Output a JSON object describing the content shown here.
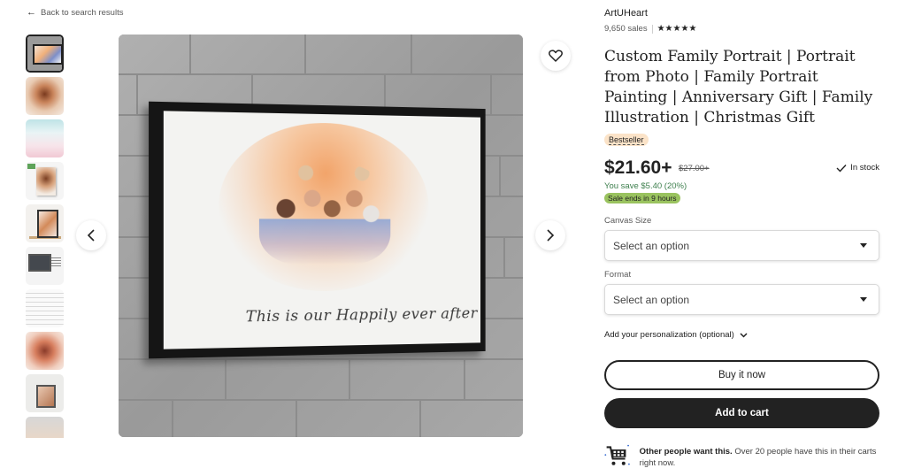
{
  "nav": {
    "back_label": "Back to search results",
    "back_icon": "arrow-left-icon"
  },
  "gallery": {
    "thumbnails": [
      {
        "alt": "Framed family portrait on brick wall",
        "active": true
      },
      {
        "alt": "Watercolor portrait close-up",
        "active": false
      },
      {
        "alt": "Step by step guide",
        "active": false
      },
      {
        "alt": "Canvas side view",
        "active": false
      },
      {
        "alt": "Framed portrait on shelf",
        "active": false
      },
      {
        "alt": "Digital download on monitor",
        "active": false
      },
      {
        "alt": "Size chart table",
        "active": false
      },
      {
        "alt": "Mother and children portrait",
        "active": false
      },
      {
        "alt": "Framed portrait interior",
        "active": false
      },
      {
        "alt": "Portrait variations",
        "active": false
      }
    ],
    "main_image": {
      "alt": "Custom watercolor family portrait canvas on grey brick wall",
      "caption_text": "This is our Happily ever after"
    },
    "prev_icon": "chevron-left-icon",
    "next_icon": "chevron-right-icon",
    "favorite_icon": "heart-icon"
  },
  "shop": {
    "name": "ArtUHeart",
    "sales": "9,650 sales",
    "rating_stars": 5,
    "stars_text": "★★★★★"
  },
  "product": {
    "title": "Custom Family Portrait | Portrait from Photo | Family Portrait Painting | Anniversary Gift | Family Illustration | Christmas Gift",
    "badge": "Bestseller",
    "price": "$21.60+",
    "original_price": "$27.00+",
    "stock_status": "In stock",
    "savings": "You save $5.40 (20%)",
    "sale_notice": "Sale ends in 9 hours"
  },
  "options": {
    "canvas_size": {
      "label": "Canvas Size",
      "value": "Select an option"
    },
    "format": {
      "label": "Format",
      "value": "Select an option"
    },
    "personalization_label": "Add your personalization (optional)"
  },
  "actions": {
    "buy_now": "Buy it now",
    "add_to_cart": "Add to cart"
  },
  "social_proof": {
    "bold": "Other people want this.",
    "text": " Over 20 people have this in their carts right now.",
    "icon": "shopping-cart-icon"
  },
  "colors": {
    "primary": "#222222",
    "savings_green": "#3d7f4d",
    "sale_pill": "#9ac35f",
    "bestseller_badge": "#fbe3c8",
    "cart_icon_accent": "#2f66d0"
  }
}
